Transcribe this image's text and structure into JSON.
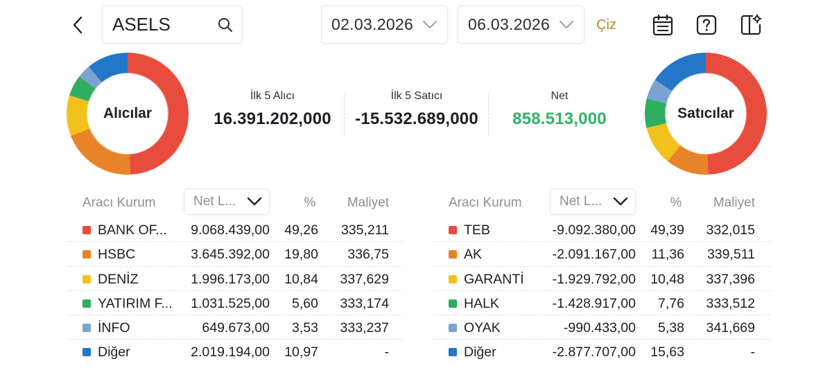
{
  "header": {
    "search": {
      "value": "ASELS",
      "placeholder": ""
    },
    "date_from": "02.03.2026",
    "date_to": "06.03.2026",
    "draw_label": "Çiz"
  },
  "summary": {
    "buyers_label": "Alıcılar",
    "sellers_label": "Satıcılar",
    "top5_buy_label": "İlk 5 Alıcı",
    "top5_buy_value": "16.391.202,000",
    "top5_sell_label": "İlk 5 Satıcı",
    "top5_sell_value": "-15.532.689,000",
    "net_label": "Net",
    "net_value": "858.513,000",
    "net_color": "#2fb36b"
  },
  "colors": {
    "red": "#e84c3d",
    "orange": "#e8832a",
    "yellow": "#f1c21b",
    "green": "#2eae5f",
    "lightblue": "#7aa3d4",
    "blue": "#2476c9",
    "accent_gold": "#b58b1e"
  },
  "buyers_table": {
    "headers": {
      "broker": "Aracı Kurum",
      "sort": "Net L...",
      "pct": "%",
      "cost": "Maliyet"
    },
    "rows": [
      {
        "name": "BANK OF...",
        "net": "9.068.439,00",
        "pct": "49,26",
        "cost": "335,211",
        "color": "#e84c3d"
      },
      {
        "name": "HSBC",
        "net": "3.645.392,00",
        "pct": "19,80",
        "cost": "336,75",
        "color": "#e8832a"
      },
      {
        "name": "DENİZ",
        "net": "1.996.173,00",
        "pct": "10,84",
        "cost": "337,629",
        "color": "#f1c21b"
      },
      {
        "name": "YATIRIM F...",
        "net": "1.031.525,00",
        "pct": "5,60",
        "cost": "333,174",
        "color": "#2eae5f"
      },
      {
        "name": "İNFO",
        "net": "649.673,00",
        "pct": "3,53",
        "cost": "333,237",
        "color": "#7aa3d4"
      },
      {
        "name": "Diğer",
        "net": "2.019.194,00",
        "pct": "10,97",
        "cost": "-",
        "color": "#2476c9"
      }
    ]
  },
  "sellers_table": {
    "headers": {
      "broker": "Aracı Kurum",
      "sort": "Net L...",
      "pct": "%",
      "cost": "Maliyet"
    },
    "rows": [
      {
        "name": "TEB",
        "net": "-9.092.380,00",
        "pct": "49,39",
        "cost": "332,015",
        "color": "#e84c3d"
      },
      {
        "name": "AK",
        "net": "-2.091.167,00",
        "pct": "11,36",
        "cost": "339,511",
        "color": "#e8832a"
      },
      {
        "name": "GARANTİ",
        "net": "-1.929.792,00",
        "pct": "10,48",
        "cost": "337,396",
        "color": "#f1c21b"
      },
      {
        "name": "HALK",
        "net": "-1.428.917,00",
        "pct": "7,76",
        "cost": "333,512",
        "color": "#2eae5f"
      },
      {
        "name": "OYAK",
        "net": "-990.433,00",
        "pct": "5,38",
        "cost": "341,669",
        "color": "#7aa3d4"
      },
      {
        "name": "Diğer",
        "net": "-2.877.707,00",
        "pct": "15,63",
        "cost": "-",
        "color": "#2476c9"
      }
    ]
  }
}
